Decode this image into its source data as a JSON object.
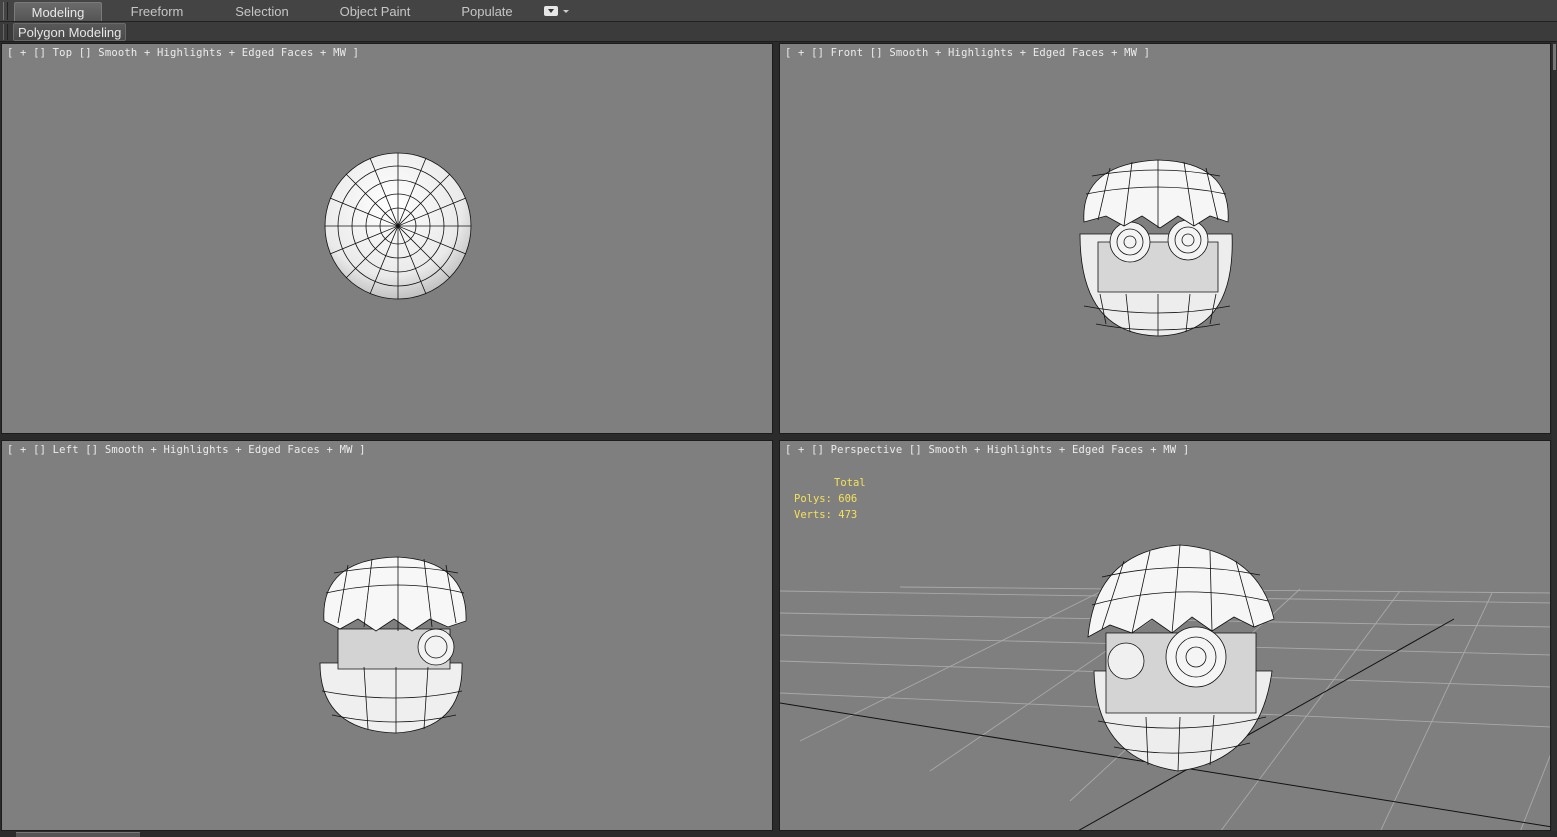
{
  "ribbon": {
    "tabs": [
      {
        "label": "Modeling",
        "active": true
      },
      {
        "label": "Freeform",
        "active": false
      },
      {
        "label": "Selection",
        "active": false
      },
      {
        "label": "Object Paint",
        "active": false
      },
      {
        "label": "Populate",
        "active": false
      }
    ],
    "menu_icon": "dropdown-menu-icon",
    "panel_label": "Polygon Modeling"
  },
  "viewports": {
    "top": {
      "label": "[ + [] Top [] Smooth + Highlights + Edged Faces + MW ]",
      "plus": "+",
      "view": "Top",
      "shading": "Smooth + Highlights + Edged Faces + MW"
    },
    "front": {
      "label": "[ + [] Front [] Smooth + Highlights + Edged Faces + MW ]",
      "plus": "+",
      "view": "Front",
      "shading": "Smooth + Highlights + Edged Faces + MW"
    },
    "left": {
      "label": "[ + [] Left [] Smooth + Highlights + Edged Faces + MW ]",
      "plus": "+",
      "view": "Left",
      "shading": "Smooth + Highlights + Edged Faces + MW"
    },
    "perspective": {
      "label": "[ + [] Perspective [] Smooth + Highlights + Edged Faces + MW ]",
      "plus": "+",
      "view": "Perspective",
      "shading": "Smooth + Highlights + Edged Faces + MW",
      "stats": {
        "total_label": "Total",
        "polys": "Polys: 606",
        "verts": "Verts: 473"
      }
    }
  },
  "colors": {
    "viewport_bg": "#7f7f7f",
    "stats_text": "#f5e25a",
    "wire": "#111111",
    "grid": "#a9a9a9"
  }
}
